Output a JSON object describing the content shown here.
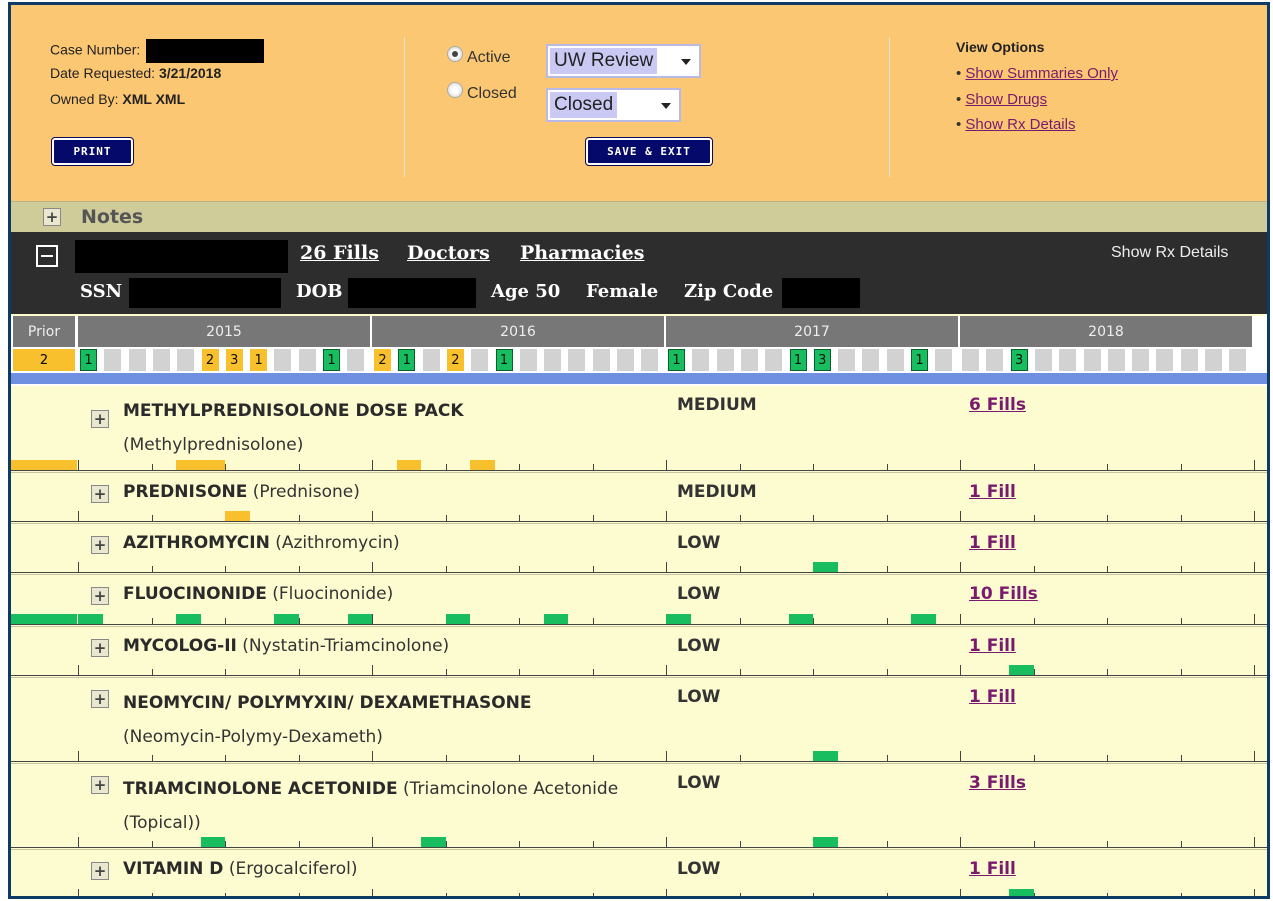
{
  "header": {
    "case_number_label": "Case Number:",
    "date_requested_label": "Date Requested:",
    "date_requested_value": "3/21/2018",
    "owned_by_label": "Owned By:",
    "owned_by_value": "XML XML",
    "print_label": "PRINT",
    "status_active_label": "Active",
    "status_closed_label": "Closed",
    "status_selected": "Active",
    "review_select_value": "UW Review",
    "closed_select_value": "Closed",
    "save_exit_label": "SAVE & EXIT",
    "view_options_title": "View Options",
    "view_options": [
      "Show Summaries Only",
      "Show Drugs",
      "Show Rx Details"
    ]
  },
  "notes": {
    "label": "Notes",
    "expander": "+"
  },
  "patient": {
    "fills_link": "26 Fills",
    "doctors_link": "Doctors",
    "pharmacies_link": "Pharmacies",
    "show_rx_details": "Show Rx Details",
    "ssn_label": "SSN",
    "dob_label": "DOB",
    "age_text": "Age 50",
    "sex": "Female",
    "zip_label": "Zip Code"
  },
  "timeline": {
    "prior_label": "Prior",
    "prior_count": "2",
    "years": [
      "2015",
      "2016",
      "2017",
      "2018"
    ],
    "months": [
      {
        "year": "2015",
        "counts": [
          "1",
          "",
          "",
          "",
          "",
          "2",
          "3",
          "1",
          "",
          "",
          "1",
          "",
          ""
        ],
        "colors": [
          "g",
          "",
          "",
          "",
          "",
          "y",
          "y",
          "y",
          "",
          "",
          "g",
          "",
          ""
        ]
      },
      {
        "year": "2016",
        "counts": [
          "2",
          "1",
          "",
          "2",
          "",
          "1",
          "",
          "",
          "",
          "",
          "",
          "",
          ""
        ],
        "colors": [
          "y",
          "g",
          "",
          "y",
          "",
          "g",
          "",
          "",
          "",
          "",
          "",
          "",
          ""
        ]
      },
      {
        "year": "2017",
        "counts": [
          "1",
          "",
          "",
          "",
          "",
          "1",
          "3",
          "",
          "",
          "",
          "1",
          "",
          ""
        ],
        "colors": [
          "g",
          "",
          "",
          "",
          "",
          "g",
          "g",
          "",
          "",
          "",
          "g",
          "",
          ""
        ]
      },
      {
        "year": "2018",
        "counts": [
          "",
          "",
          "3",
          "",
          "",
          "",
          "",
          "",
          "",
          "",
          "",
          "",
          ""
        ],
        "colors": [
          "",
          "",
          "g",
          "",
          "",
          "",
          "",
          "",
          "",
          "",
          "",
          "",
          ""
        ]
      }
    ]
  },
  "drugs": [
    {
      "name": "METHYLPREDNISOLONE DOSE PACK",
      "generic": "(Methylprednisolone)",
      "risk": "MEDIUM",
      "fills": "6 Fills",
      "color": "#f8c02c",
      "fill_months": [
        -1,
        4,
        5,
        13,
        16
      ]
    },
    {
      "name": "PREDNISONE",
      "generic": "(Prednisone)",
      "risk": "MEDIUM",
      "fills": "1 Fill",
      "color": "#f8c02c",
      "fill_months": [
        6
      ]
    },
    {
      "name": "AZITHROMYCIN",
      "generic": "(Azithromycin)",
      "risk": "LOW",
      "fills": "1 Fill",
      "color": "#17bd5e",
      "fill_months": [
        30
      ]
    },
    {
      "name": "FLUOCINONIDE",
      "generic": "(Fluocinonide)",
      "risk": "LOW",
      "fills": "10 Fills",
      "color": "#17bd5e",
      "fill_months": [
        -1,
        0,
        4,
        8,
        11,
        15,
        19,
        24,
        29,
        34
      ]
    },
    {
      "name": "MYCOLOG-II",
      "generic": "(Nystatin-Triamcinolone)",
      "risk": "LOW",
      "fills": "1 Fill",
      "color": "#17bd5e",
      "fill_months": [
        38
      ]
    },
    {
      "name": "NEOMYCIN/ POLYMYXIN/ DEXAMETHASONE",
      "generic": "(Neomycin-Polymy-Dexameth)",
      "risk": "LOW",
      "fills": "1 Fill",
      "color": "#17bd5e",
      "fill_months": [
        30
      ]
    },
    {
      "name": "TRIAMCINOLONE ACETONIDE",
      "generic": "(Triamcinolone Acetonide (Topical))",
      "risk": "LOW",
      "fills": "3 Fills",
      "color": "#17bd5e",
      "fill_months": [
        5,
        14,
        30
      ]
    },
    {
      "name": "VITAMIN D",
      "generic": "(Ergocalciferol)",
      "risk": "LOW",
      "fills": "1 Fill",
      "color": "#17bd5e",
      "fill_months": [
        38
      ]
    }
  ]
}
